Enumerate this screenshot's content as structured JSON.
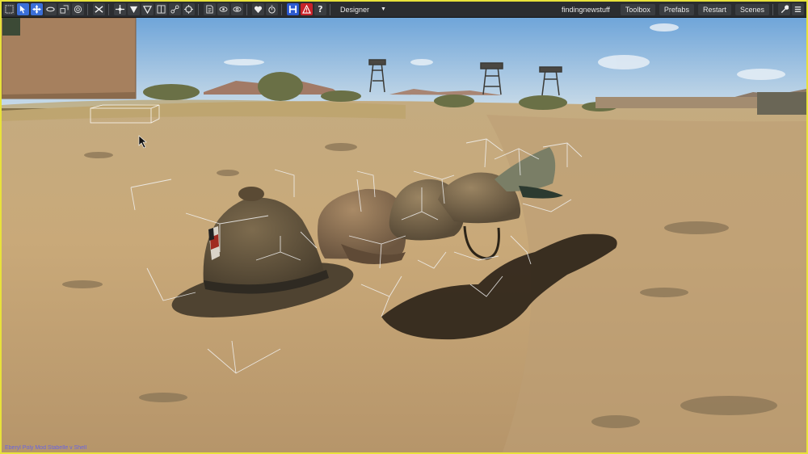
{
  "toolbar": {
    "mode": "Designer",
    "project": "findingnewstuff",
    "tabs": [
      "Toolbox",
      "Prefabs",
      "Restart",
      "Scenes"
    ],
    "icons": [
      "select-icon",
      "pointer-icon",
      "move-icon",
      "rotate-icon",
      "scale-icon",
      "pivot-icon",
      "cut-icon",
      "snap-icon",
      "terrain-down-icon",
      "terrain-icon",
      "split-icon",
      "link-icon",
      "target-icon",
      "file-icon",
      "eye-icon",
      "visibility-icon",
      "heart-icon",
      "timer-icon",
      "save-icon",
      "warning-icon",
      "help-icon"
    ]
  },
  "colors": {
    "frame": "#e8e23a",
    "toolbar_bg": "#2b2d30",
    "active_tool": "#3b6fd8",
    "warning": "#c8232a",
    "sky": "#86b8e3",
    "sand": "#c9a979"
  },
  "scene": {
    "objects": [
      "pith-helmet",
      "field-cap",
      "steel-helmet",
      "peaked-cap"
    ],
    "status": "Eberyl Poly Mod Stabelle v Shell"
  }
}
